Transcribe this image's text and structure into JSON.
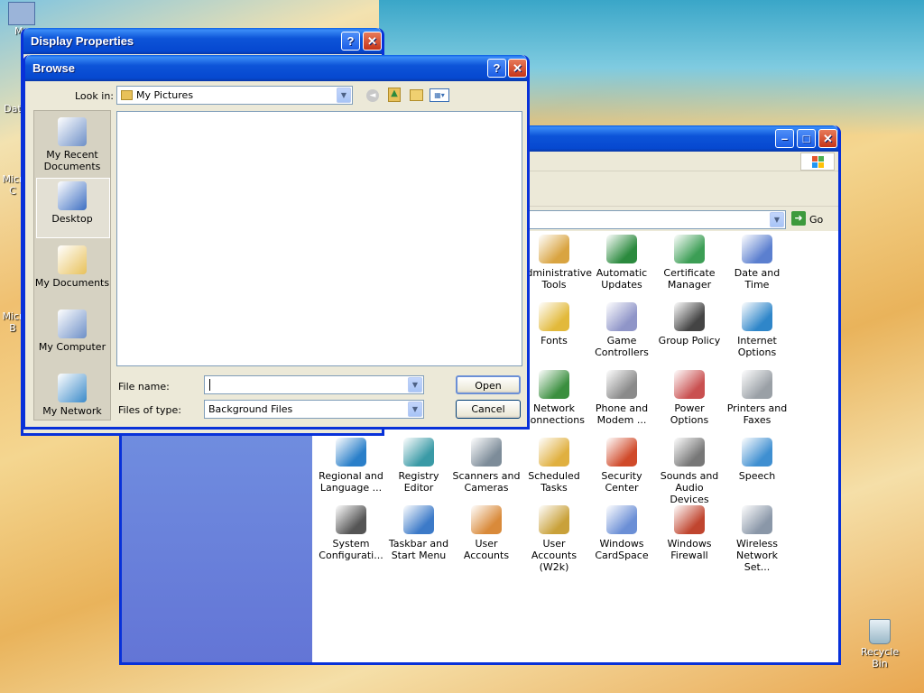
{
  "desktop": {
    "icons": [
      {
        "label": "My"
      },
      {
        "label": "Dat"
      },
      {
        "label": "Micr C"
      },
      {
        "label": "Micr B"
      },
      {
        "label": "Recycle Bin"
      }
    ]
  },
  "display_props": {
    "title": "Display Properties",
    "help": "?",
    "close": "✕"
  },
  "control_panel": {
    "go_label": "Go",
    "items": [
      {
        "label": "Administrative Tools",
        "icon": "admin-tools-icon",
        "color": "#d9a441"
      },
      {
        "label": "Automatic Updates",
        "icon": "windows-update-icon",
        "color": "#2b8a3e"
      },
      {
        "label": "Certificate Manager",
        "icon": "certificate-icon",
        "color": "#3c9e55"
      },
      {
        "label": "Date and Time",
        "icon": "clock-calendar-icon",
        "color": "#5b7fcf"
      },
      {
        "label": "Fonts",
        "icon": "fonts-folder-icon",
        "color": "#e2b93b"
      },
      {
        "label": "Game Controllers",
        "icon": "gamepad-icon",
        "color": "#8f95c8"
      },
      {
        "label": "Group Policy",
        "icon": "group-policy-icon",
        "color": "#444"
      },
      {
        "label": "Internet Options",
        "icon": "globe-icon",
        "color": "#2f86c9"
      },
      {
        "label": "Network Connections",
        "icon": "network-globe-icon",
        "color": "#3b8f3f"
      },
      {
        "label": "Phone and Modem ...",
        "icon": "phone-icon",
        "color": "#8a8a8a"
      },
      {
        "label": "Power Options",
        "icon": "power-plug-icon",
        "color": "#c95050"
      },
      {
        "label": "Printers and Faxes",
        "icon": "printer-icon",
        "color": "#9aa0a6"
      },
      {
        "label": "Regional and Language ...",
        "icon": "globe-stand-icon",
        "color": "#2a7fc9"
      },
      {
        "label": "Registry Editor",
        "icon": "registry-icon",
        "color": "#3a9aa6"
      },
      {
        "label": "Scanners and Cameras",
        "icon": "scanner-camera-icon",
        "color": "#7d8c99"
      },
      {
        "label": "Scheduled Tasks",
        "icon": "scheduled-tasks-icon",
        "color": "#e0b040"
      },
      {
        "label": "Security Center",
        "icon": "shield-icon",
        "color": "#d04a2a"
      },
      {
        "label": "Sounds and Audio Devices",
        "icon": "speaker-icon",
        "color": "#777"
      },
      {
        "label": "Speech",
        "icon": "speech-icon",
        "color": "#3f8fd1"
      },
      {
        "label": "System Configurati...",
        "icon": "system-config-icon",
        "color": "#555"
      },
      {
        "label": "Taskbar and Start Menu",
        "icon": "taskbar-icon",
        "color": "#3c7ac8"
      },
      {
        "label": "User Accounts",
        "icon": "users-icon",
        "color": "#d98a3a"
      },
      {
        "label": "User Accounts (W2k)",
        "icon": "users-key-icon",
        "color": "#c9a13a"
      },
      {
        "label": "Windows CardSpace",
        "icon": "cardspace-icon",
        "color": "#6b8fd6"
      },
      {
        "label": "Windows Firewall",
        "icon": "firewall-icon",
        "color": "#c0452f"
      },
      {
        "label": "Wireless Network Set...",
        "icon": "wireless-icon",
        "color": "#8a97a8"
      }
    ]
  },
  "browse": {
    "title": "Browse",
    "help": "?",
    "close": "✕",
    "look_in_label": "Look in:",
    "look_in_value": "My Pictures",
    "places": [
      {
        "label": "My Recent Documents",
        "icon": "recent-docs-icon"
      },
      {
        "label": "Desktop",
        "icon": "desktop-icon"
      },
      {
        "label": "My Documents",
        "icon": "my-documents-icon"
      },
      {
        "label": "My Computer",
        "icon": "my-computer-icon"
      },
      {
        "label": "My Network",
        "icon": "my-network-icon"
      }
    ],
    "file_name_label": "File name:",
    "file_name_value": "",
    "files_of_type_label": "Files of type:",
    "files_of_type_value": "Background Files",
    "open_label": "Open",
    "cancel_label": "Cancel"
  }
}
